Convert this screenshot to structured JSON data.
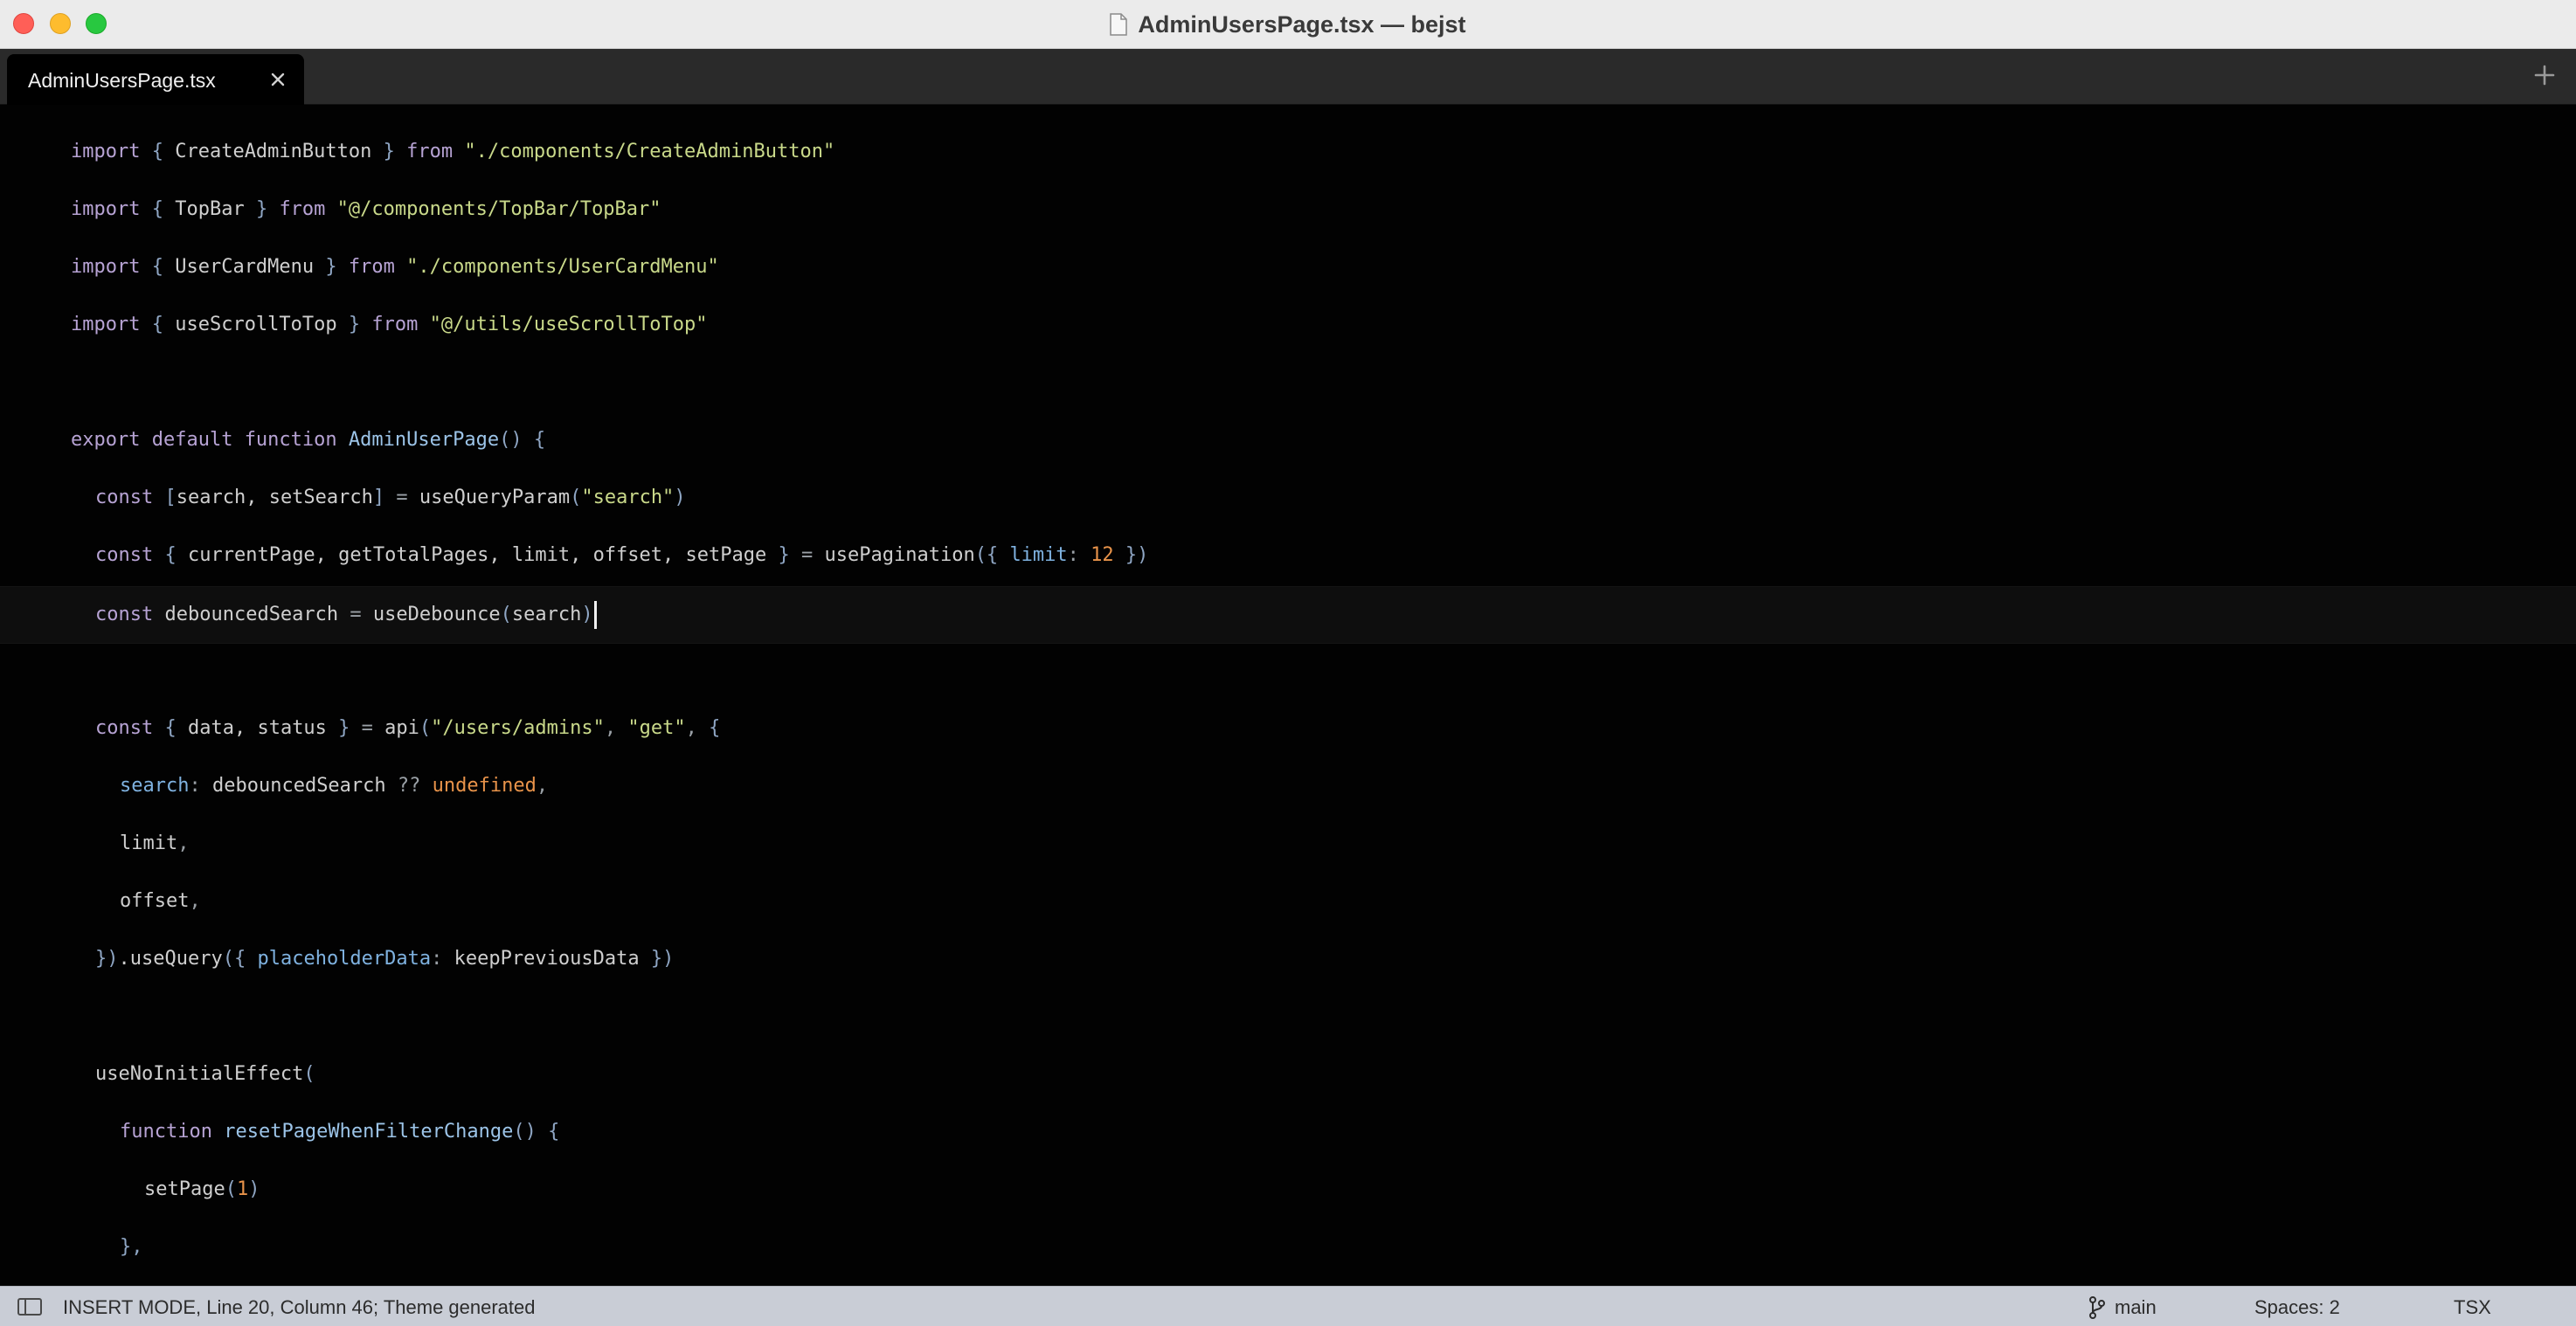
{
  "window": {
    "title": "AdminUsersPage.tsx — bejst"
  },
  "tabs": [
    {
      "label": "AdminUsersPage.tsx",
      "active": true
    }
  ],
  "icons": {
    "close": "close-icon",
    "add_tab": "plus-icon",
    "document": "document-icon",
    "branch": "git-branch-icon",
    "panel": "sidebar-toggle-icon"
  },
  "code": {
    "lines": [
      {
        "indent": 0,
        "tokens": [
          {
            "t": "import ",
            "c": "kw"
          },
          {
            "t": "{ ",
            "c": "br"
          },
          {
            "t": "CreateAdminButton ",
            "c": "id"
          },
          {
            "t": "} ",
            "c": "br"
          },
          {
            "t": "from ",
            "c": "kw"
          },
          {
            "t": "\"./components/CreateAdminButton\"",
            "c": "str"
          }
        ]
      },
      {
        "indent": 0,
        "tokens": [
          {
            "t": "import ",
            "c": "kw"
          },
          {
            "t": "{ ",
            "c": "br"
          },
          {
            "t": "TopBar ",
            "c": "id"
          },
          {
            "t": "} ",
            "c": "br"
          },
          {
            "t": "from ",
            "c": "kw"
          },
          {
            "t": "\"@/components/TopBar/TopBar\"",
            "c": "str"
          }
        ]
      },
      {
        "indent": 0,
        "tokens": [
          {
            "t": "import ",
            "c": "kw"
          },
          {
            "t": "{ ",
            "c": "br"
          },
          {
            "t": "UserCardMenu ",
            "c": "id"
          },
          {
            "t": "} ",
            "c": "br"
          },
          {
            "t": "from ",
            "c": "kw"
          },
          {
            "t": "\"./components/UserCardMenu\"",
            "c": "str"
          }
        ]
      },
      {
        "indent": 0,
        "tokens": [
          {
            "t": "import ",
            "c": "kw"
          },
          {
            "t": "{ ",
            "c": "br"
          },
          {
            "t": "useScrollToTop ",
            "c": "id"
          },
          {
            "t": "} ",
            "c": "br"
          },
          {
            "t": "from ",
            "c": "kw"
          },
          {
            "t": "\"@/utils/useScrollToTop\"",
            "c": "str"
          }
        ]
      },
      {
        "indent": 0,
        "tokens": []
      },
      {
        "indent": 0,
        "tokens": [
          {
            "t": "export ",
            "c": "kw"
          },
          {
            "t": "default ",
            "c": "kw"
          },
          {
            "t": "function ",
            "c": "kw"
          },
          {
            "t": "AdminUserPage",
            "c": "fn"
          },
          {
            "t": "() ",
            "c": "br"
          },
          {
            "t": "{",
            "c": "br"
          }
        ]
      },
      {
        "indent": 1,
        "tokens": [
          {
            "t": "const ",
            "c": "kw"
          },
          {
            "t": "[",
            "c": "br"
          },
          {
            "t": "search, setSearch",
            "c": "id"
          },
          {
            "t": "] ",
            "c": "br"
          },
          {
            "t": "= ",
            "c": "pn"
          },
          {
            "t": "useQueryParam",
            "c": "id"
          },
          {
            "t": "(",
            "c": "br"
          },
          {
            "t": "\"search\"",
            "c": "str"
          },
          {
            "t": ")",
            "c": "br"
          }
        ]
      },
      {
        "indent": 1,
        "tokens": [
          {
            "t": "const ",
            "c": "kw"
          },
          {
            "t": "{ ",
            "c": "br"
          },
          {
            "t": "currentPage, getTotalPages, limit, offset, setPage ",
            "c": "id"
          },
          {
            "t": "} ",
            "c": "br"
          },
          {
            "t": "= ",
            "c": "pn"
          },
          {
            "t": "usePagination",
            "c": "id"
          },
          {
            "t": "({ ",
            "c": "br"
          },
          {
            "t": "limit",
            "c": "prop"
          },
          {
            "t": ": ",
            "c": "pn"
          },
          {
            "t": "12",
            "c": "num"
          },
          {
            "t": " })",
            "c": "br"
          }
        ]
      },
      {
        "indent": 1,
        "current": true,
        "cursor": true,
        "tokens": [
          {
            "t": "const ",
            "c": "kw"
          },
          {
            "t": "debouncedSearch ",
            "c": "id"
          },
          {
            "t": "= ",
            "c": "pn"
          },
          {
            "t": "useDebounce",
            "c": "id"
          },
          {
            "t": "(",
            "c": "br"
          },
          {
            "t": "search",
            "c": "id"
          },
          {
            "t": ")",
            "c": "br"
          }
        ]
      },
      {
        "indent": 0,
        "tokens": []
      },
      {
        "indent": 1,
        "tokens": [
          {
            "t": "const ",
            "c": "kw"
          },
          {
            "t": "{ ",
            "c": "br"
          },
          {
            "t": "data, status ",
            "c": "id"
          },
          {
            "t": "} ",
            "c": "br"
          },
          {
            "t": "= ",
            "c": "pn"
          },
          {
            "t": "api",
            "c": "id"
          },
          {
            "t": "(",
            "c": "br"
          },
          {
            "t": "\"/users/admins\"",
            "c": "str"
          },
          {
            "t": ", ",
            "c": "pn"
          },
          {
            "t": "\"get\"",
            "c": "str"
          },
          {
            "t": ", ",
            "c": "pn"
          },
          {
            "t": "{",
            "c": "br"
          }
        ]
      },
      {
        "indent": 2,
        "tokens": [
          {
            "t": "search",
            "c": "prop"
          },
          {
            "t": ": ",
            "c": "pn"
          },
          {
            "t": "debouncedSearch ",
            "c": "id"
          },
          {
            "t": "?? ",
            "c": "pn"
          },
          {
            "t": "undefined",
            "c": "undef"
          },
          {
            "t": ",",
            "c": "pn"
          }
        ]
      },
      {
        "indent": 2,
        "tokens": [
          {
            "t": "limit",
            "c": "id"
          },
          {
            "t": ",",
            "c": "pn"
          }
        ]
      },
      {
        "indent": 2,
        "tokens": [
          {
            "t": "offset",
            "c": "id"
          },
          {
            "t": ",",
            "c": "pn"
          }
        ]
      },
      {
        "indent": 1,
        "tokens": [
          {
            "t": "})",
            "c": "br"
          },
          {
            "t": ".useQuery",
            "c": "id"
          },
          {
            "t": "({ ",
            "c": "br"
          },
          {
            "t": "placeholderData",
            "c": "prop"
          },
          {
            "t": ": ",
            "c": "pn"
          },
          {
            "t": "keepPreviousData ",
            "c": "id"
          },
          {
            "t": "})",
            "c": "br"
          }
        ]
      },
      {
        "indent": 0,
        "tokens": []
      },
      {
        "indent": 1,
        "tokens": [
          {
            "t": "useNoInitialEffect",
            "c": "id"
          },
          {
            "t": "(",
            "c": "br"
          }
        ]
      },
      {
        "indent": 2,
        "tokens": [
          {
            "t": "function ",
            "c": "kw"
          },
          {
            "t": "resetPageWhenFilterChange",
            "c": "fn"
          },
          {
            "t": "() ",
            "c": "br"
          },
          {
            "t": "{",
            "c": "br"
          }
        ]
      },
      {
        "indent": 3,
        "tokens": [
          {
            "t": "setPage",
            "c": "id"
          },
          {
            "t": "(",
            "c": "br"
          },
          {
            "t": "1",
            "c": "num"
          },
          {
            "t": ")",
            "c": "br"
          }
        ]
      },
      {
        "indent": 2,
        "tokens": [
          {
            "t": "},",
            "c": "br"
          }
        ]
      }
    ]
  },
  "status": {
    "mode_text": "INSERT MODE, Line 20, Column 46; Theme generated",
    "branch": "main",
    "indentation": "Spaces: 2",
    "syntax": "TSX"
  }
}
